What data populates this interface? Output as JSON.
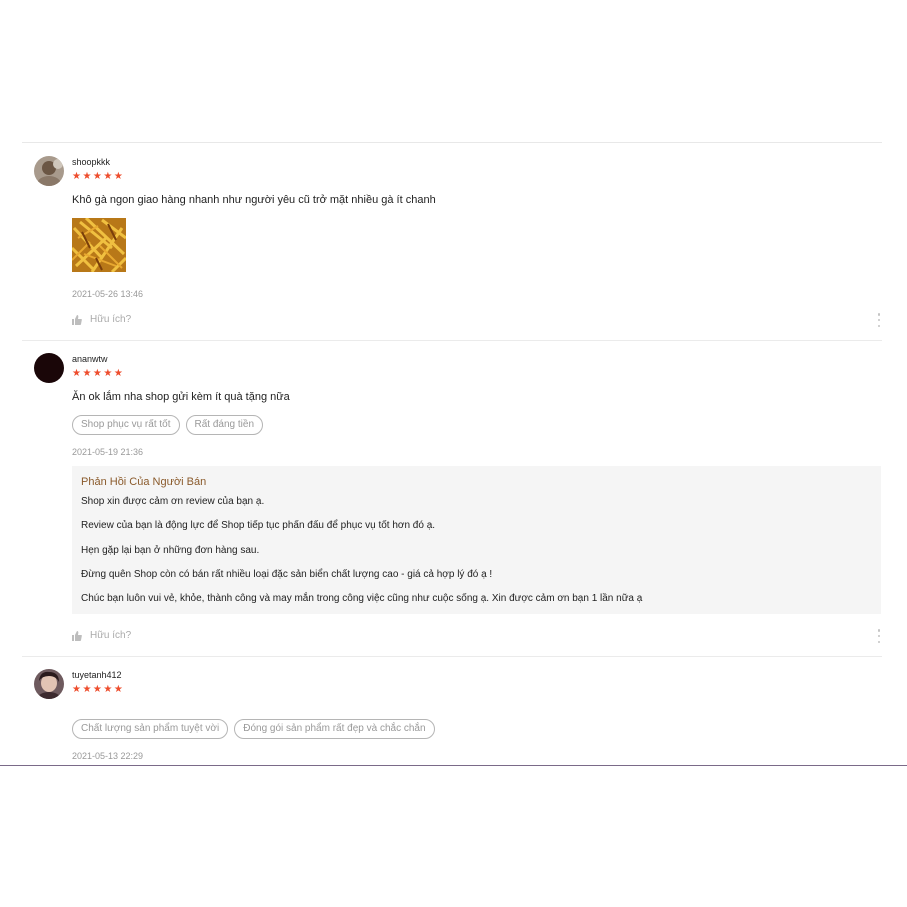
{
  "reviews": [
    {
      "username": "shoopkkk",
      "stars": "★★★★★",
      "comment": "Khô gà ngon giao hàng nhanh như người yêu cũ trở mặt nhiều gà ít chanh",
      "date": "2021-05-26 13:46",
      "helpful": "Hữu ích?"
    },
    {
      "username": "ananwtw",
      "stars": "★★★★★",
      "comment": "Ăn ok lắm nha shop gửi kèm ít quà tặng nữa",
      "tags": [
        "Shop phục vụ rất tốt",
        "Rất đáng tiền"
      ],
      "date": "2021-05-19 21:36",
      "reply": {
        "title": "Phản Hồi Của Người Bán",
        "lines": [
          "Shop xin được cảm ơn review của bạn ạ.",
          "Review của bạn là động lực để Shop tiếp tục phấn đấu để phục vụ tốt hơn đó ạ.",
          "Hẹn gặp lại bạn ở những đơn hàng sau.",
          "Đừng quên Shop còn có bán rất nhiều loại đặc sản biển chất lượng cao - giá cả hợp lý đó ạ !",
          "Chúc bạn luôn vui vẻ, khỏe, thành công và may mắn trong công việc cũng như cuộc sống ạ. Xin được cảm ơn bạn 1 lần nữa ạ"
        ]
      },
      "helpful": "Hữu ích?"
    },
    {
      "username": "tuyetanh412",
      "stars": "★★★★★",
      "tags": [
        "Chất lượng sản phẩm tuyệt vời",
        "Đóng gói sản phẩm rất đẹp và chắc chắn"
      ],
      "date": "2021-05-13 22:29"
    }
  ],
  "colors": {
    "star": "#ee4d2d",
    "reply_title": "#8a5a2b",
    "reply_bg": "#f5f5f5"
  },
  "icons": {
    "helpful": "thumbs-up-icon",
    "more": "more-vertical-icon",
    "rating": "star-icon"
  }
}
